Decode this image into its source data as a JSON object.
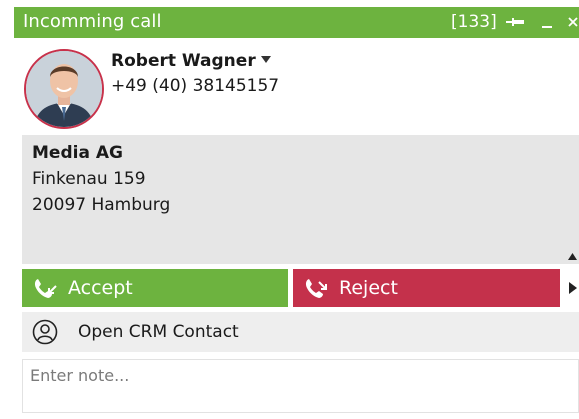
{
  "window": {
    "title": "Incomming call",
    "count": "[133]"
  },
  "caller": {
    "name": "Robert Wagner",
    "phone": "+49 (40) 38145157"
  },
  "address": {
    "company": "Media AG",
    "street": "Finkenau 159",
    "city": "20097 Hamburg"
  },
  "actions": {
    "accept_label": "Accept",
    "reject_label": "Reject",
    "crm_label": "Open CRM Contact"
  },
  "note": {
    "placeholder": "Enter note..."
  },
  "colors": {
    "accent_green": "#6db33f",
    "reject_red": "#c4314b",
    "avatar_ring": "#c8314a"
  },
  "icons": [
    "pin-icon",
    "minimize-icon",
    "close-icon",
    "chevron-down-icon",
    "scroll-up-icon",
    "phone-accept-icon",
    "phone-reject-icon",
    "chevron-right-icon",
    "person-icon"
  ]
}
